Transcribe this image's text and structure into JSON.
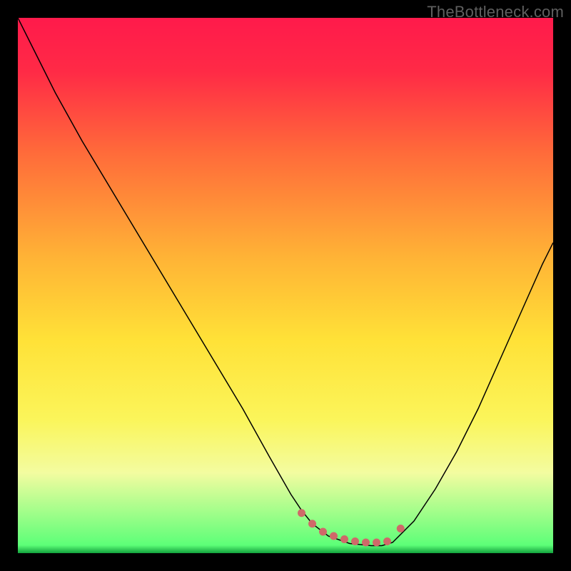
{
  "watermark": "TheBottleneck.com",
  "chart_data": {
    "type": "line",
    "title": "",
    "xlabel": "",
    "ylabel": "",
    "xlim": [
      0,
      100
    ],
    "ylim": [
      0,
      100
    ],
    "background_gradient_stops": [
      {
        "offset": 0.0,
        "color": "#ff1a4b"
      },
      {
        "offset": 0.1,
        "color": "#ff2a46"
      },
      {
        "offset": 0.25,
        "color": "#ff6a3a"
      },
      {
        "offset": 0.45,
        "color": "#ffb436"
      },
      {
        "offset": 0.6,
        "color": "#ffe137"
      },
      {
        "offset": 0.75,
        "color": "#fbf55a"
      },
      {
        "offset": 0.85,
        "color": "#f3fca0"
      },
      {
        "offset": 0.985,
        "color": "#5dff78"
      },
      {
        "offset": 1.0,
        "color": "#12a23d"
      }
    ],
    "series": [
      {
        "name": "bottleneck-curve",
        "stroke": "#000000",
        "stroke_width": 1.5,
        "x": [
          0,
          3,
          7,
          12,
          18,
          24,
          30,
          36,
          42,
          47,
          51,
          53,
          55,
          58,
          62,
          66,
          68,
          70,
          74,
          78,
          82,
          86,
          90,
          94,
          98,
          100
        ],
        "y": [
          100,
          94,
          86,
          77,
          67,
          57,
          47,
          37,
          27,
          18,
          11,
          8,
          5.5,
          3.2,
          1.8,
          1.4,
          1.4,
          2.0,
          6,
          12,
          19,
          27,
          36,
          45,
          54,
          58
        ]
      }
    ],
    "highlight_band": {
      "name": "optimal-region",
      "color": "#cf6969",
      "dot_radius": 5.5,
      "x": [
        53,
        55,
        57,
        59,
        61,
        63,
        65,
        67,
        69,
        71.5
      ],
      "y": [
        7.5,
        5.5,
        4.0,
        3.2,
        2.6,
        2.2,
        2.0,
        2.0,
        2.2,
        4.6
      ]
    }
  }
}
